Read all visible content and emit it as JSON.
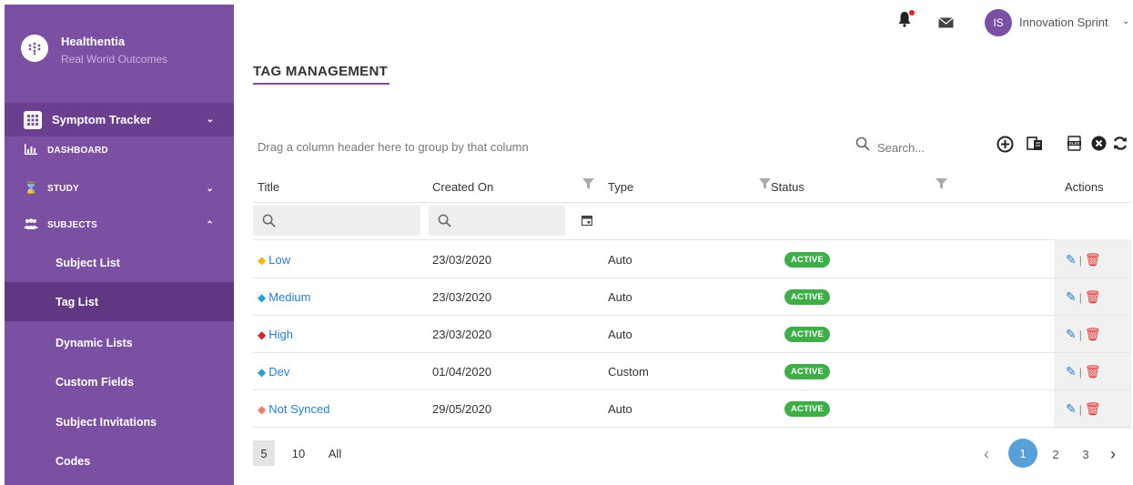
{
  "brand": {
    "name": "Healthentia",
    "subtitle": "Real World Outcomes",
    "logo_glyph": "#"
  },
  "sidebar": {
    "module": {
      "label": "Symptom Tracker",
      "icon": "grid-icon"
    },
    "nav": [
      {
        "label": "DASHBOARD",
        "icon": "bar-chart-icon"
      },
      {
        "label": "STUDY",
        "icon": "hourglass-icon"
      },
      {
        "label": "SUBJECTS",
        "icon": "people-icon"
      }
    ],
    "subitems": [
      {
        "label": "Subject List"
      },
      {
        "label": "Tag List"
      },
      {
        "label": "Dynamic Lists"
      },
      {
        "label": "Custom Fields"
      },
      {
        "label": "Subject Invitations"
      },
      {
        "label": "Codes"
      }
    ]
  },
  "topbar": {
    "avatar_initials": "IS",
    "user_name": "Innovation Sprint"
  },
  "page": {
    "title": "TAG MANAGEMENT"
  },
  "toolbar": {
    "group_hint": "Drag a column header here to group by that column",
    "search_placeholder": "Search..."
  },
  "grid": {
    "columns": [
      "Title",
      "Created On",
      "Type",
      "Status",
      "Actions"
    ],
    "rows": [
      {
        "title": "Low",
        "tag_color": "#f2b51c",
        "created_on": "23/03/2020",
        "type": "Auto",
        "status": "ACTIVE"
      },
      {
        "title": "Medium",
        "tag_color": "#2a9fd6",
        "created_on": "23/03/2020",
        "type": "Auto",
        "status": "ACTIVE"
      },
      {
        "title": "High",
        "tag_color": "#d8232a",
        "created_on": "23/03/2020",
        "type": "Auto",
        "status": "ACTIVE"
      },
      {
        "title": "Dev",
        "tag_color": "#2a9fd6",
        "created_on": "01/04/2020",
        "type": "Custom",
        "status": "ACTIVE"
      },
      {
        "title": "Not Synced",
        "tag_color": "#ec7b6a",
        "created_on": "29/05/2020",
        "type": "Auto",
        "status": "ACTIVE"
      }
    ]
  },
  "footer": {
    "page_sizes": [
      "5",
      "10",
      "All"
    ],
    "pages": [
      "1",
      "2",
      "3"
    ]
  },
  "colors": {
    "brand": "#7b4fa1",
    "active_badge": "#3fae49",
    "link": "#2a7ccf",
    "delete": "#e03030"
  }
}
